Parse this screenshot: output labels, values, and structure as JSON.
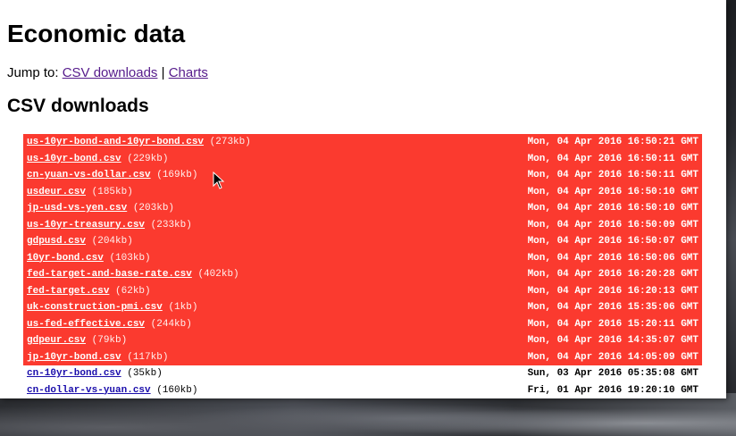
{
  "page": {
    "title": "Economic data",
    "jump_label": "Jump to:",
    "jump_links": [
      "CSV downloads",
      "Charts"
    ],
    "jump_separator": "|",
    "section_title": "CSV downloads"
  },
  "highlight_color": "#fb3a2f",
  "files": [
    {
      "name": "us-10yr-bond-and-10yr-bond.csv",
      "size": "(273kb)",
      "date": "Mon, 04 Apr 2016 16:50:21 GMT",
      "highlighted": true
    },
    {
      "name": "us-10yr-bond.csv",
      "size": "(229kb)",
      "date": "Mon, 04 Apr 2016 16:50:11 GMT",
      "highlighted": true
    },
    {
      "name": "cn-yuan-vs-dollar.csv",
      "size": "(169kb)",
      "date": "Mon, 04 Apr 2016 16:50:11 GMT",
      "highlighted": true
    },
    {
      "name": "usdeur.csv",
      "size": "(185kb)",
      "date": "Mon, 04 Apr 2016 16:50:10 GMT",
      "highlighted": true
    },
    {
      "name": "jp-usd-vs-yen.csv",
      "size": "(203kb)",
      "date": "Mon, 04 Apr 2016 16:50:10 GMT",
      "highlighted": true
    },
    {
      "name": "us-10yr-treasury.csv",
      "size": "(233kb)",
      "date": "Mon, 04 Apr 2016 16:50:09 GMT",
      "highlighted": true
    },
    {
      "name": "gdpusd.csv",
      "size": "(204kb)",
      "date": "Mon, 04 Apr 2016 16:50:07 GMT",
      "highlighted": true
    },
    {
      "name": "10yr-bond.csv",
      "size": "(103kb)",
      "date": "Mon, 04 Apr 2016 16:50:06 GMT",
      "highlighted": true
    },
    {
      "name": "fed-target-and-base-rate.csv",
      "size": "(402kb)",
      "date": "Mon, 04 Apr 2016 16:20:28 GMT",
      "highlighted": true
    },
    {
      "name": "fed-target.csv",
      "size": "(62kb)",
      "date": "Mon, 04 Apr 2016 16:20:13 GMT",
      "highlighted": true
    },
    {
      "name": "uk-construction-pmi.csv",
      "size": "(1kb)",
      "date": "Mon, 04 Apr 2016 15:35:06 GMT",
      "highlighted": true
    },
    {
      "name": "us-fed-effective.csv",
      "size": "(244kb)",
      "date": "Mon, 04 Apr 2016 15:20:11 GMT",
      "highlighted": true
    },
    {
      "name": "gdpeur.csv",
      "size": "(79kb)",
      "date": "Mon, 04 Apr 2016 14:35:07 GMT",
      "highlighted": true
    },
    {
      "name": "jp-10yr-bond.csv",
      "size": "(117kb)",
      "date": "Mon, 04 Apr 2016 14:05:09 GMT",
      "highlighted": true
    },
    {
      "name": "cn-10yr-bond.csv",
      "size": "(35kb)",
      "date": "Sun, 03 Apr 2016 05:35:08 GMT",
      "highlighted": false
    },
    {
      "name": "cn-dollar-vs-yuan.csv",
      "size": "(160kb)",
      "date": "Fri, 01 Apr 2016 19:20:10 GMT",
      "highlighted": false
    }
  ]
}
